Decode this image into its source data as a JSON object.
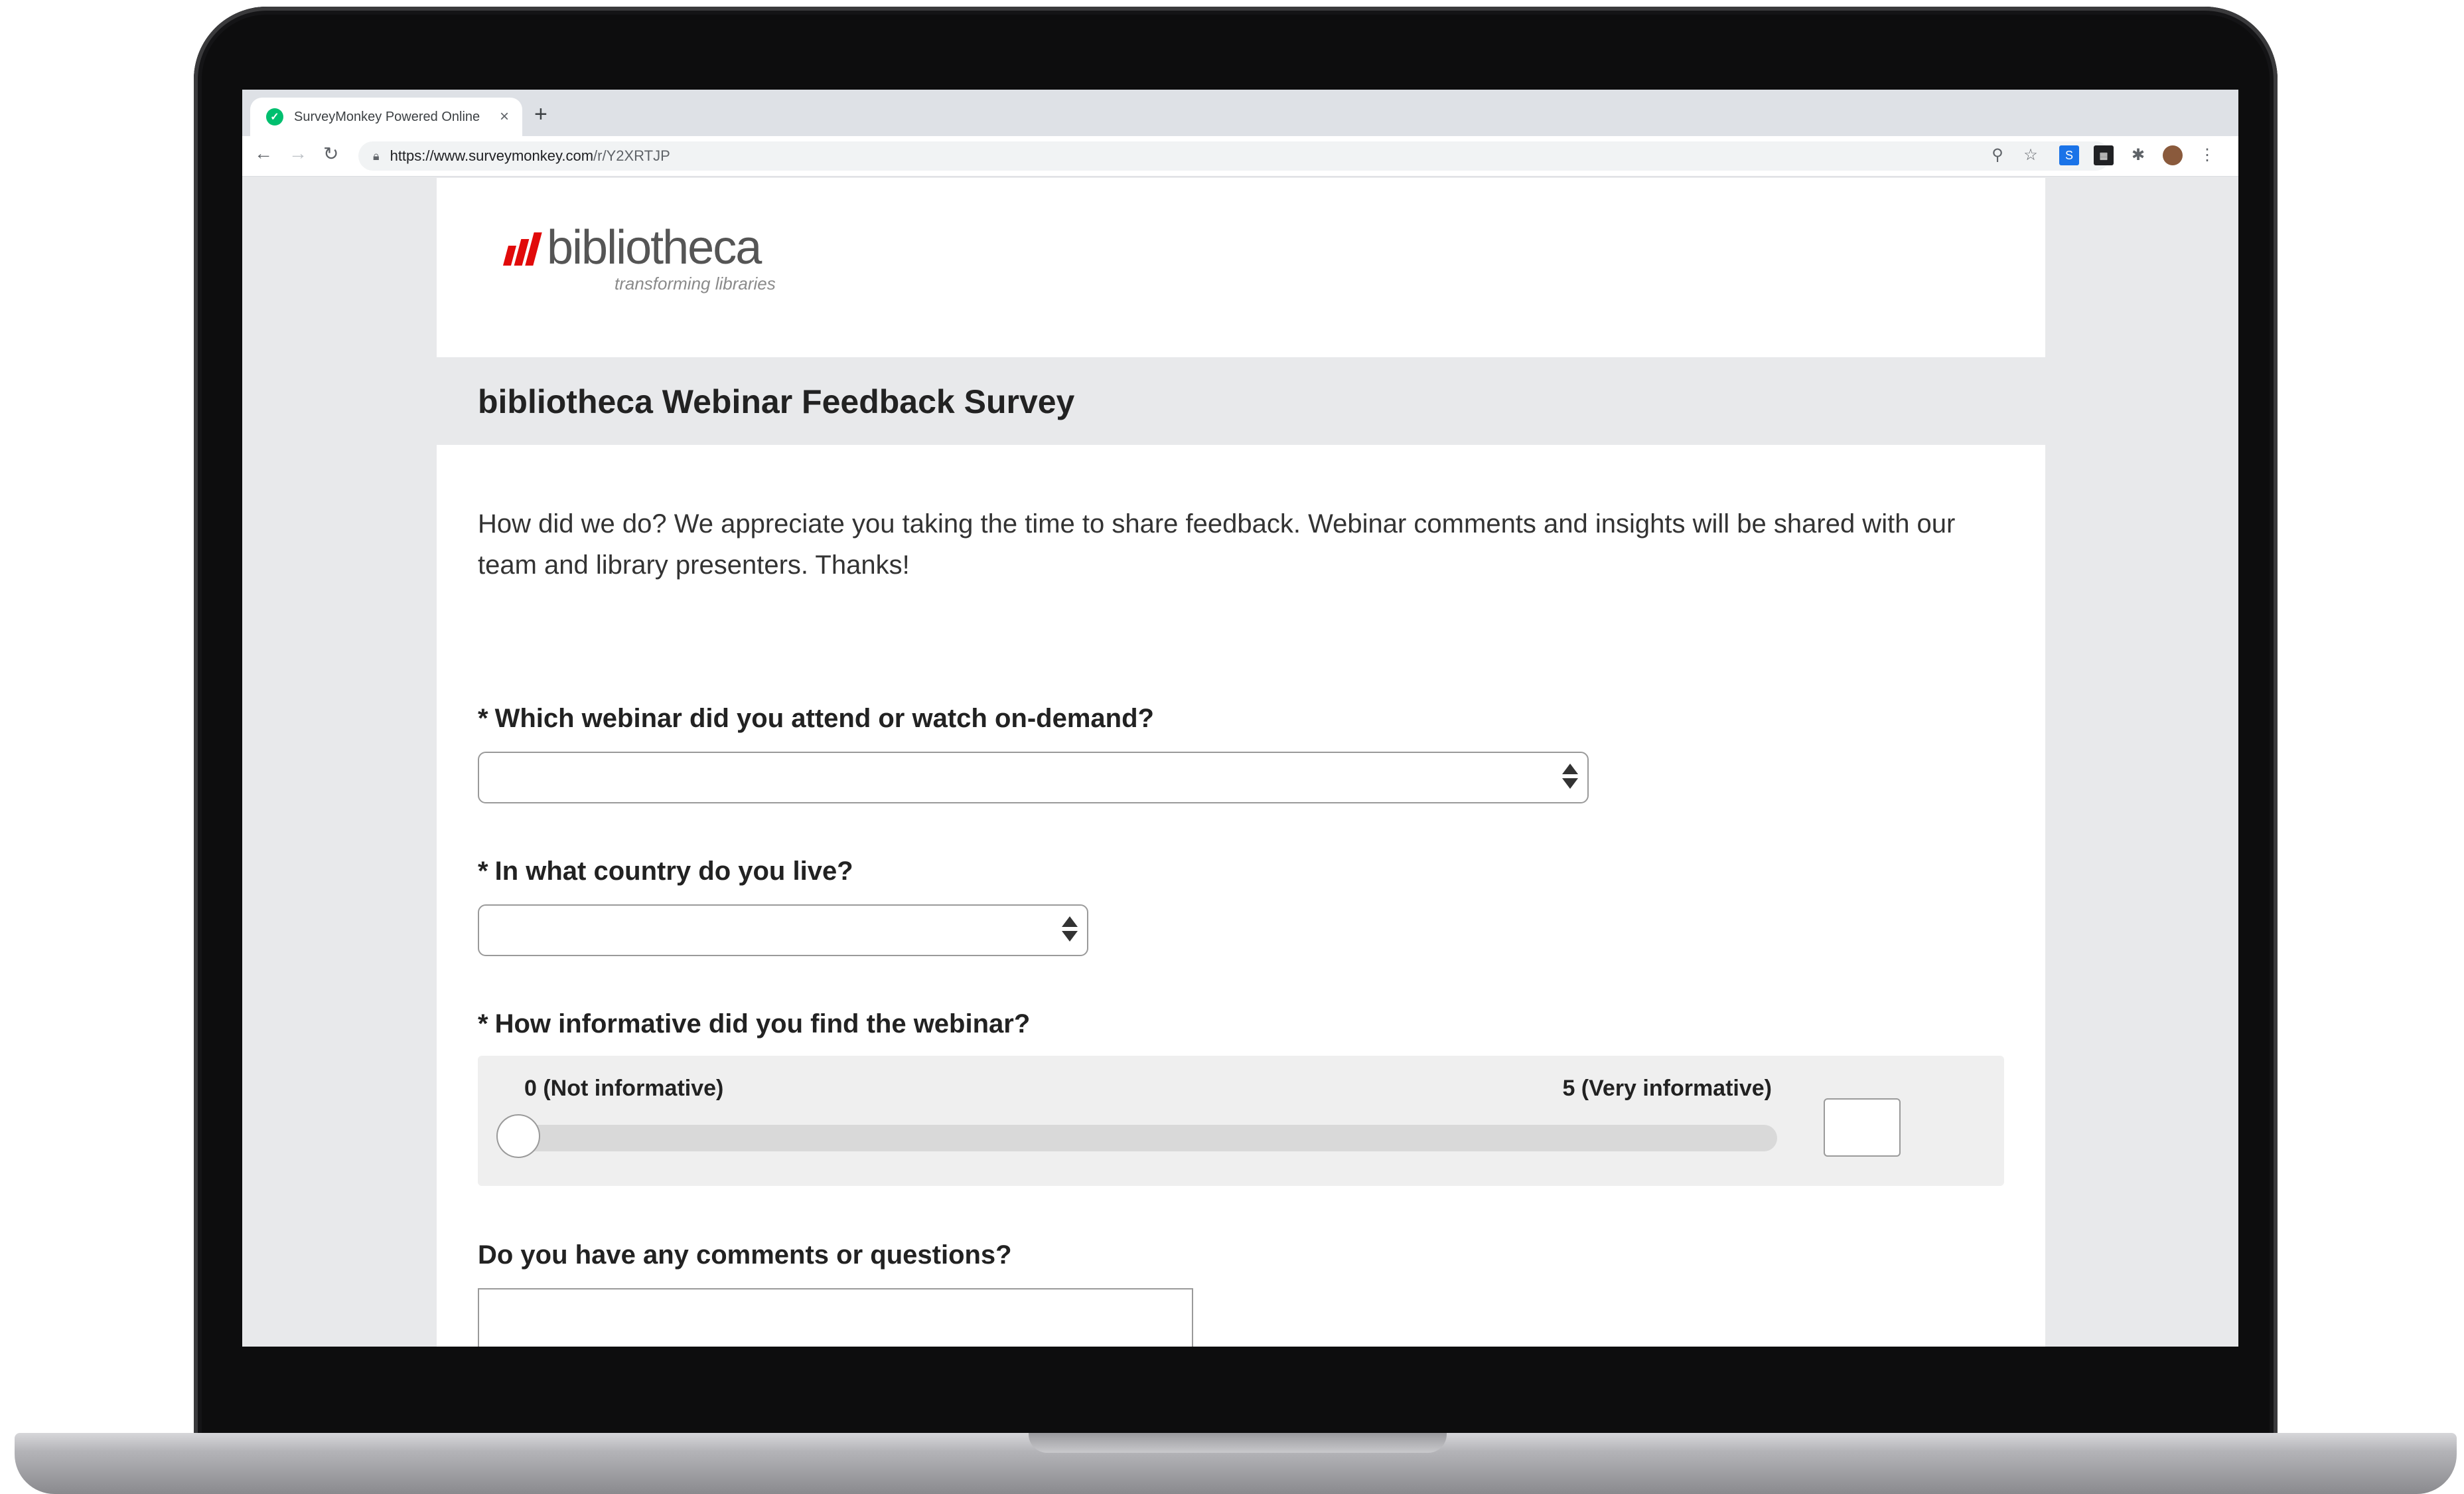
{
  "browser": {
    "tab_title": "SurveyMonkey Powered Online",
    "tab_close": "×",
    "new_tab": "+",
    "url_host": "https://www.surveymonkey.com",
    "url_path": "/r/Y2XRTJP"
  },
  "logo": {
    "wordmark": "bibliotheca",
    "tagline": "transforming libraries",
    "brand_color": "#e10a0a"
  },
  "survey": {
    "title": "bibliotheca Webinar Feedback Survey",
    "intro": "How did we do? We appreciate you taking the time to share feedback. Webinar comments and insights will be shared with our team and library presenters. Thanks!",
    "q1": {
      "required": "*",
      "label": "Which webinar did you attend or watch on-demand?",
      "value": ""
    },
    "q2": {
      "required": "*",
      "label": "In what country do you live?",
      "value": ""
    },
    "q3": {
      "required": "*",
      "label": "How informative did you find the webinar?",
      "min_label": "0 (Not informative)",
      "max_label": "5 (Very informative)",
      "value": 0
    },
    "q4": {
      "label": "Do you have any comments or questions?",
      "value": ""
    }
  }
}
